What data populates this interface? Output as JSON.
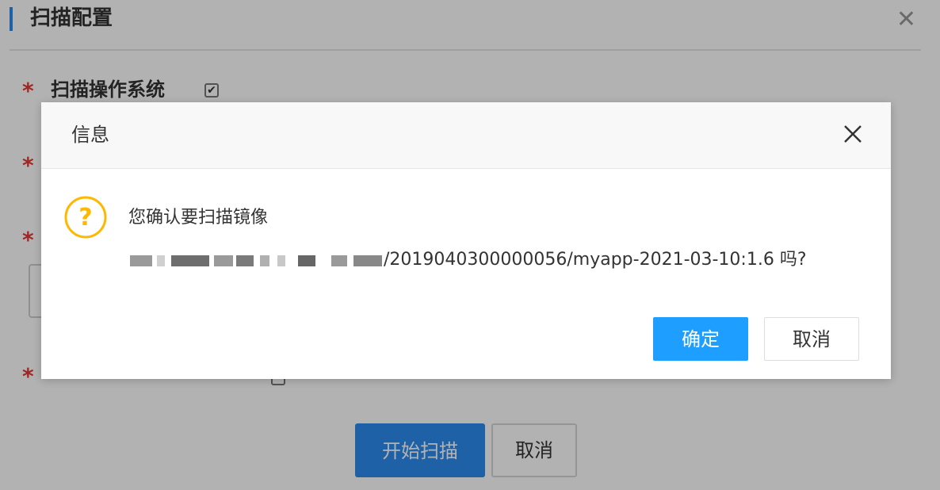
{
  "panel": {
    "title": "扫描配置",
    "close_icon": "close-icon",
    "fields": [
      {
        "label": "扫描操作系统",
        "required": true,
        "checked": true
      },
      {
        "label": "",
        "required": true
      },
      {
        "label": "",
        "required": true
      },
      {
        "label": "",
        "required": true,
        "checked": false
      }
    ],
    "start_scan_label": "开始扫描",
    "cancel_label": "取消"
  },
  "dialog": {
    "title": "信息",
    "close_icon": "close-icon",
    "icon": "question-icon",
    "message_line1": "您确认要扫描镜像",
    "message_line2": "/2019040300000056/myapp-2021-03-10:1.6 吗?",
    "confirm_label": "确定",
    "cancel_label": "取消"
  },
  "colors": {
    "primary": "#1e9fff",
    "panel_button": "#2d8cf0",
    "warning_icon": "#ffb800",
    "required_star": "#e53935"
  }
}
